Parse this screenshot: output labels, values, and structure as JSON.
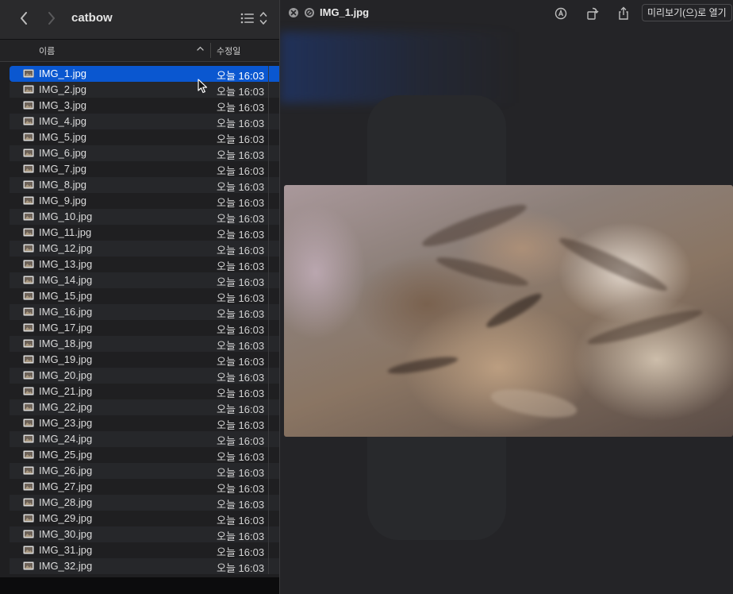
{
  "finder": {
    "folder_title": "catbow",
    "columns": {
      "name": "이름",
      "date": "수정일"
    },
    "files": [
      {
        "name": "IMG_1.jpg",
        "date": "오늘 16:03",
        "selected": true
      },
      {
        "name": "IMG_2.jpg",
        "date": "오늘 16:03"
      },
      {
        "name": "IMG_3.jpg",
        "date": "오늘 16:03"
      },
      {
        "name": "IMG_4.jpg",
        "date": "오늘 16:03"
      },
      {
        "name": "IMG_5.jpg",
        "date": "오늘 16:03"
      },
      {
        "name": "IMG_6.jpg",
        "date": "오늘 16:03"
      },
      {
        "name": "IMG_7.jpg",
        "date": "오늘 16:03"
      },
      {
        "name": "IMG_8.jpg",
        "date": "오늘 16:03"
      },
      {
        "name": "IMG_9.jpg",
        "date": "오늘 16:03"
      },
      {
        "name": "IMG_10.jpg",
        "date": "오늘 16:03"
      },
      {
        "name": "IMG_11.jpg",
        "date": "오늘 16:03"
      },
      {
        "name": "IMG_12.jpg",
        "date": "오늘 16:03"
      },
      {
        "name": "IMG_13.jpg",
        "date": "오늘 16:03"
      },
      {
        "name": "IMG_14.jpg",
        "date": "오늘 16:03"
      },
      {
        "name": "IMG_15.jpg",
        "date": "오늘 16:03"
      },
      {
        "name": "IMG_16.jpg",
        "date": "오늘 16:03"
      },
      {
        "name": "IMG_17.jpg",
        "date": "오늘 16:03"
      },
      {
        "name": "IMG_18.jpg",
        "date": "오늘 16:03"
      },
      {
        "name": "IMG_19.jpg",
        "date": "오늘 16:03"
      },
      {
        "name": "IMG_20.jpg",
        "date": "오늘 16:03"
      },
      {
        "name": "IMG_21.jpg",
        "date": "오늘 16:03"
      },
      {
        "name": "IMG_22.jpg",
        "date": "오늘 16:03"
      },
      {
        "name": "IMG_23.jpg",
        "date": "오늘 16:03"
      },
      {
        "name": "IMG_24.jpg",
        "date": "오늘 16:03"
      },
      {
        "name": "IMG_25.jpg",
        "date": "오늘 16:03"
      },
      {
        "name": "IMG_26.jpg",
        "date": "오늘 16:03"
      },
      {
        "name": "IMG_27.jpg",
        "date": "오늘 16:03"
      },
      {
        "name": "IMG_28.jpg",
        "date": "오늘 16:03"
      },
      {
        "name": "IMG_29.jpg",
        "date": "오늘 16:03"
      },
      {
        "name": "IMG_30.jpg",
        "date": "오늘 16:03"
      },
      {
        "name": "IMG_31.jpg",
        "date": "오늘 16:03"
      },
      {
        "name": "IMG_32.jpg",
        "date": "오늘 16:03"
      }
    ]
  },
  "quicklook": {
    "title": "IMG_1.jpg",
    "open_with_label": "미리보기(으)로 열기",
    "icons": [
      "close-icon",
      "block-icon",
      "markup-icon",
      "rotate-icon",
      "share-icon"
    ]
  },
  "colors": {
    "selection": "#0a57d0",
    "finder_bg": "#1f1f21",
    "quicklook_bg": "#242427"
  }
}
